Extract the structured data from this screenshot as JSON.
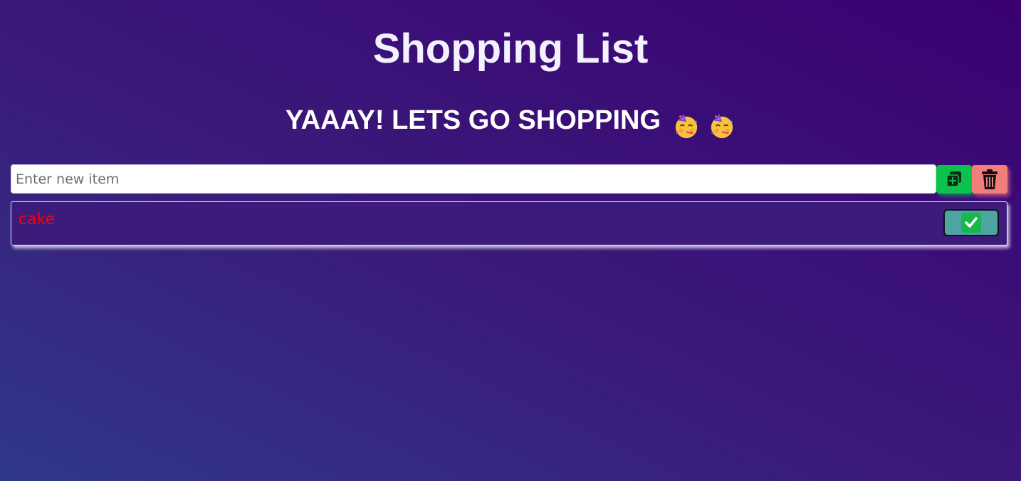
{
  "header": {
    "title": "Shopping List",
    "subtitle": "YAAAY! LETS GO SHOPPING"
  },
  "icons": {
    "subtitle_emoji": [
      "party-face-emoji",
      "party-face-emoji"
    ],
    "add": "add-copy-icon",
    "delete": "trash-icon",
    "check": "check-mark-icon"
  },
  "new_item": {
    "placeholder": "Enter new item",
    "value": ""
  },
  "items": [
    {
      "label": "cake"
    }
  ],
  "colors": {
    "add_button": "#0ac24c",
    "delete_button": "#f27e7c",
    "item_text": "#ff0000",
    "check_button": "#4ea3a3",
    "check_box": "#16b84a"
  }
}
